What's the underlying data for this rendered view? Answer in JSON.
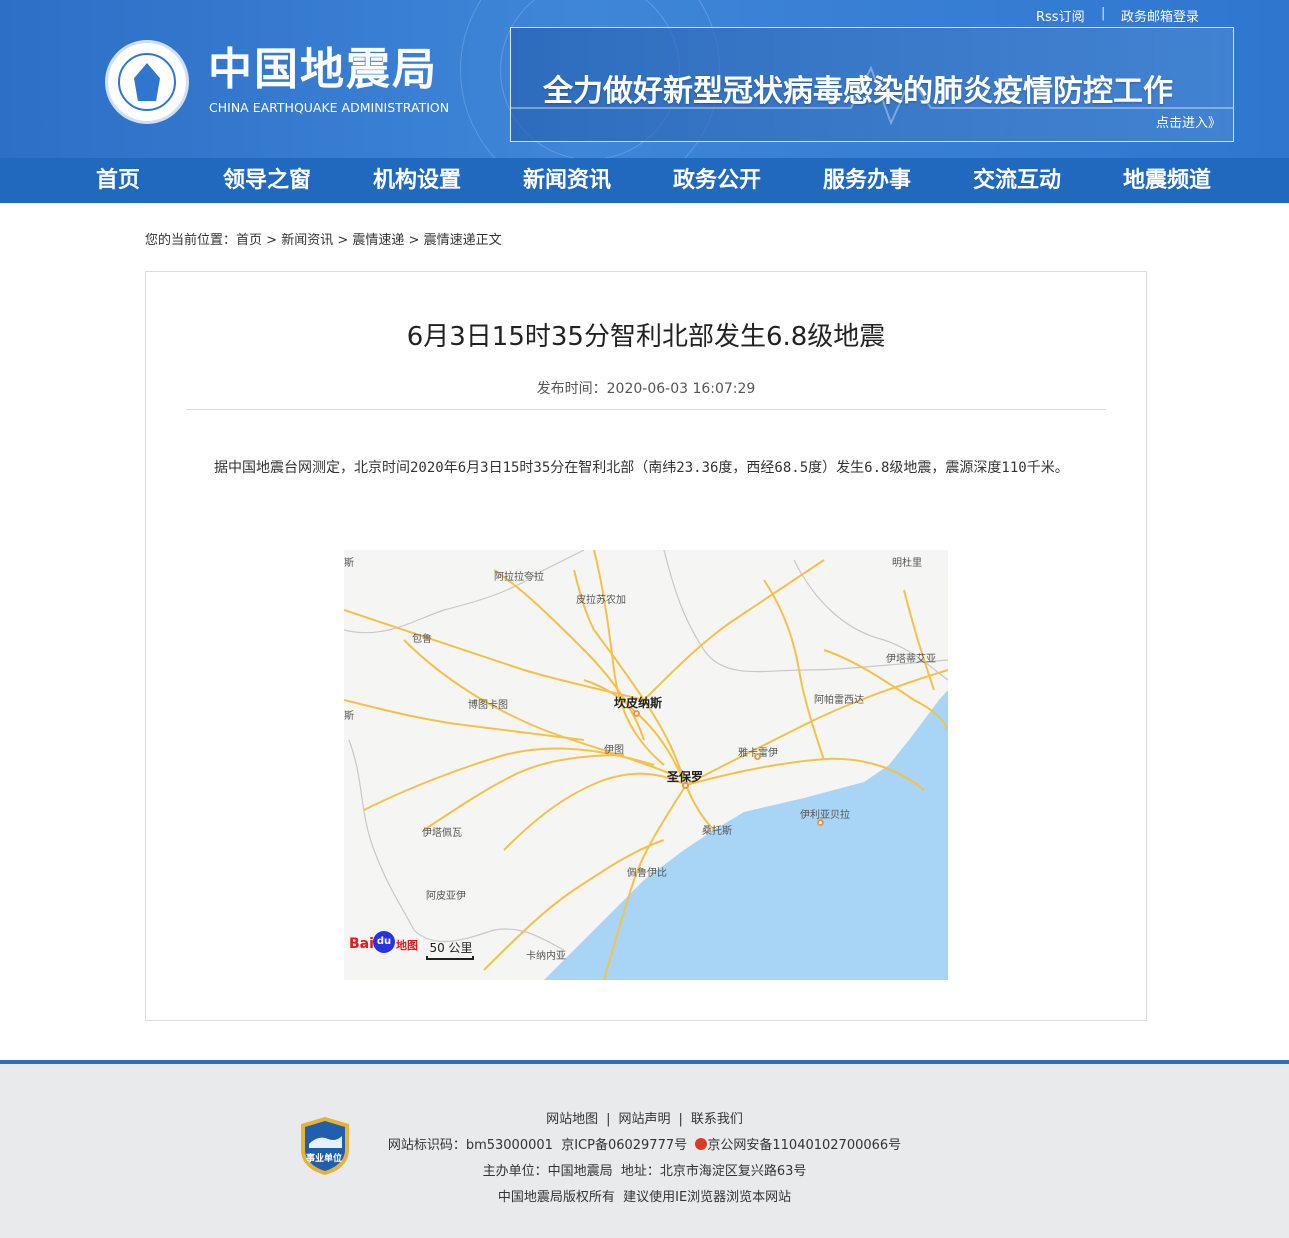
{
  "top_links": {
    "rss": "Rss订阅",
    "separator": "|",
    "mail": "政务邮箱登录"
  },
  "site": {
    "title": "中国地震局",
    "subtitle": "CHINA EARTHQUAKE ADMINISTRATION"
  },
  "banner": {
    "title": "全力做好新型冠状病毒感染的肺炎疫情防控工作",
    "link": "点击进入》"
  },
  "nav": {
    "items": [
      "首页",
      "领导之窗",
      "机构设置",
      "新闻资讯",
      "政务公开",
      "服务办事",
      "交流互动",
      "地震频道"
    ]
  },
  "breadcrumb": {
    "prefix": "您的当前位置：",
    "items": [
      "首页",
      "新闻资讯",
      "震情速递",
      "震情速递正文"
    ],
    "separator": " > "
  },
  "article": {
    "title": "6月3日15时35分智利北部发生6.8级地震",
    "publish_label": "发布时间：",
    "publish_time": "2020-06-03 16:07:29",
    "body": "据中国地震台网测定，北京时间2020年6月3日15时35分在智利北部（南纬23.36度，西经68.5度）发生6.8级地震，震源深度110千米。"
  },
  "map": {
    "cities_small": [
      "斯",
      "阿拉拉夸拉",
      "皮拉苏农加",
      "明杜里",
      "包鲁",
      "伊塔蒂艾亚",
      "博图卡图",
      "阿帕雷西达",
      "斯",
      "伊图",
      "雅卡雷伊",
      "伊利亚贝拉",
      "伊塔佩瓦",
      "桑托斯",
      "佩鲁伊比",
      "阿皮亚伊",
      "卡纳内亚"
    ],
    "cities_big": [
      "坎皮纳斯",
      "圣保罗"
    ],
    "logo_text": "Bai",
    "logo_du": "du",
    "logo_suffix": "地图",
    "scale": "50 公里"
  },
  "footer": {
    "badge_text": "事业单位",
    "links": [
      "网站地图",
      "网站声明",
      "联系我们"
    ],
    "link_separator": "|",
    "id_label": "网站标识码：",
    "id_value": "bm53000001",
    "icp": "京ICP备06029777号",
    "police": "京公网安备11040102700066号",
    "sponsor": "主办单位：中国地震局",
    "address": "地址：北京市海淀区复兴路63号",
    "copyright": "中国地震局版权所有",
    "browser_tip": "建议使用IE浏览器浏览本网站"
  },
  "colors": {
    "header": "#3f86d8",
    "nav": "#2168bf",
    "footer_border": "#2f6ebd",
    "sea": "#a8d4f5",
    "road": "#f5c14b"
  }
}
